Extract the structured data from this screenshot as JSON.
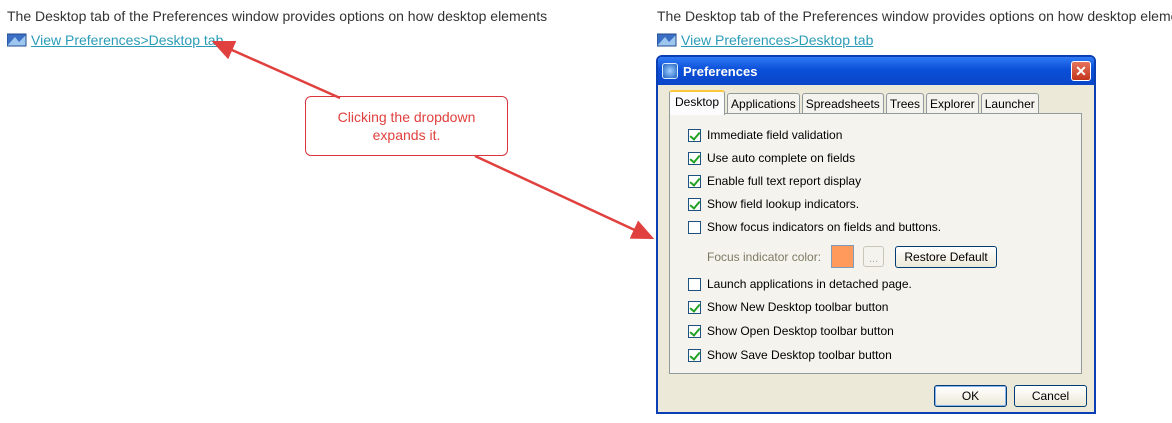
{
  "left": {
    "intro": "The Desktop tab of the Preferences window provides options on how desktop elements",
    "link": "View Preferences>Desktop tab"
  },
  "right": {
    "intro": "The Desktop tab of the Preferences window provides options on how desktop elements",
    "link": "View Preferences>Desktop tab"
  },
  "callout": "Clicking the dropdown\nexpands it.",
  "callout_color": "#e0413e",
  "window": {
    "title": "Preferences",
    "close_icon": "close-icon",
    "tabs": [
      "Desktop",
      "Applications",
      "Spreadsheets",
      "Trees",
      "Explorer",
      "Launcher"
    ],
    "active_tab": "Desktop",
    "options": [
      {
        "label": "Immediate field validation",
        "checked": true
      },
      {
        "label": "Use auto complete on fields",
        "checked": true
      },
      {
        "label": "Enable full text report display",
        "checked": true
      },
      {
        "label": "Show field lookup indicators.",
        "checked": true
      },
      {
        "label": "Show focus indicators on fields and buttons.",
        "checked": false
      },
      {
        "label": "Launch applications in detached page.",
        "checked": false
      },
      {
        "label": "Show New Desktop toolbar button",
        "checked": true
      },
      {
        "label": "Show Open Desktop toolbar button",
        "checked": true
      },
      {
        "label": "Show Save Desktop toolbar button",
        "checked": true
      }
    ],
    "focus_color_label": "Focus indicator color:",
    "focus_color": "#ff9a5c",
    "browse_label": "...",
    "restore_label": "Restore Default",
    "ok_label": "OK",
    "cancel_label": "Cancel"
  }
}
